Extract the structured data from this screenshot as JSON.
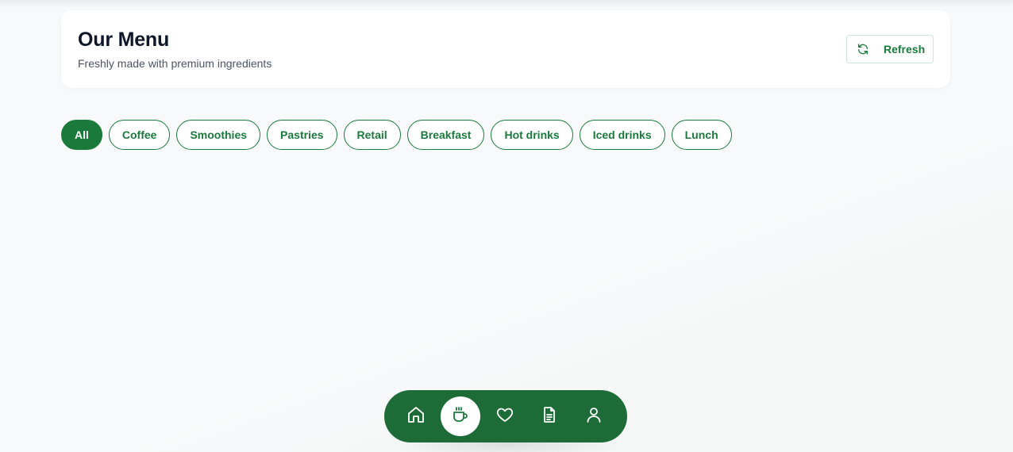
{
  "header": {
    "title": "Our Menu",
    "subtitle": "Freshly made with premium ingredients",
    "refresh_label": "Refresh"
  },
  "categories": [
    {
      "label": "All",
      "active": true
    },
    {
      "label": "Coffee",
      "active": false
    },
    {
      "label": "Smoothies",
      "active": false
    },
    {
      "label": "Pastries",
      "active": false
    },
    {
      "label": "Retail",
      "active": false
    },
    {
      "label": "Breakfast",
      "active": false
    },
    {
      "label": "Hot drinks",
      "active": false
    },
    {
      "label": "Iced drinks",
      "active": false
    },
    {
      "label": "Lunch",
      "active": false
    }
  ],
  "bottom_nav": {
    "items": [
      {
        "icon": "home-icon",
        "active": false
      },
      {
        "icon": "coffee-cup-icon",
        "active": true
      },
      {
        "icon": "heart-icon",
        "active": false
      },
      {
        "icon": "document-icon",
        "active": false
      },
      {
        "icon": "user-icon",
        "active": false
      }
    ]
  },
  "colors": {
    "brand": "#1a7a3c",
    "nav_bg": "#1d6b36",
    "title": "#0f172a",
    "subtitle": "#4b5563"
  }
}
